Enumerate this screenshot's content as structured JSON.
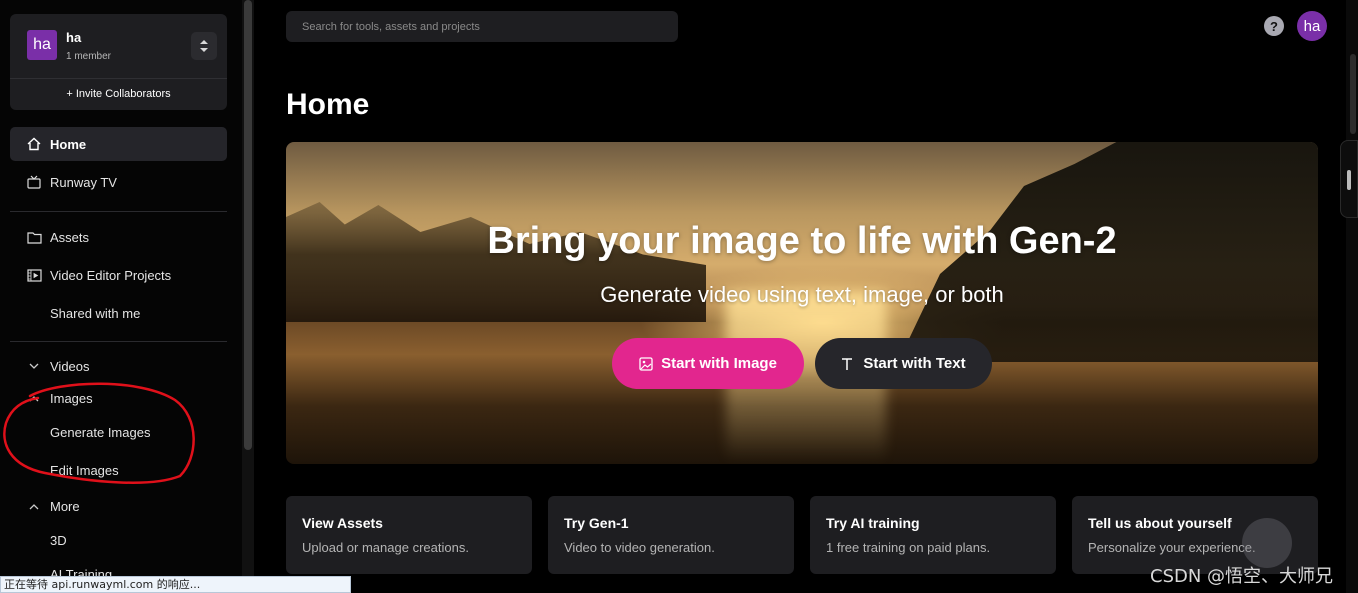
{
  "team": {
    "avatar": "ha",
    "name": "ha",
    "members": "1 member",
    "invite": "+ Invite Collaborators"
  },
  "sidebar": {
    "items": [
      {
        "label": "Home",
        "icon": "home-icon",
        "active": true
      },
      {
        "label": "Runway TV",
        "icon": "tv-icon"
      },
      {
        "label": "Assets",
        "icon": "folder-icon"
      },
      {
        "label": "Video Editor Projects",
        "icon": "video-editor-icon"
      },
      {
        "label": "Shared with me"
      }
    ],
    "sections": [
      {
        "label": "Videos",
        "expanded": false
      },
      {
        "label": "Images",
        "expanded": true,
        "children": [
          "Generate Images",
          "Edit Images"
        ]
      },
      {
        "label": "More",
        "expanded": true,
        "children": [
          "3D",
          "AI Training"
        ]
      }
    ]
  },
  "search": {
    "placeholder": "Search for tools, assets and projects"
  },
  "header": {
    "help": "?",
    "user_avatar": "ha"
  },
  "page": {
    "title": "Home"
  },
  "hero": {
    "title": "Bring your image to life with Gen-2",
    "subtitle": "Generate video using text, image, or both",
    "primary_button": "Start with Image",
    "secondary_button": "Start with Text"
  },
  "cards": [
    {
      "title": "View Assets",
      "desc": "Upload or manage creations."
    },
    {
      "title": "Try Gen-1",
      "desc": "Video to video generation."
    },
    {
      "title": "Try AI training",
      "desc": "1 free training on paid plans."
    },
    {
      "title": "Tell us about yourself",
      "desc": "Personalize your experience."
    }
  ],
  "status_bar": "正在等待 api.runwayml.com 的响应...",
  "watermark": "CSDN @悟空、大师兄",
  "colors": {
    "accent_pink": "#e2268e",
    "avatar_purple": "#7a2fa8",
    "annotation_red": "#e0101a"
  }
}
